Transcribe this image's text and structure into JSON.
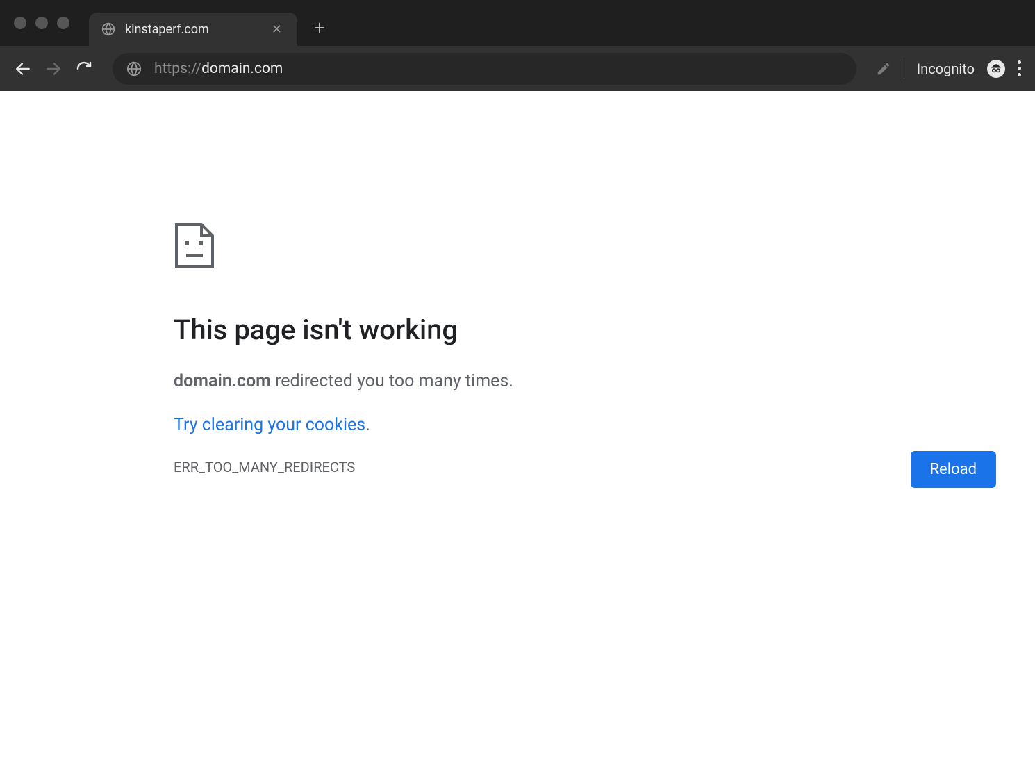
{
  "browser": {
    "tab": {
      "title": "kinstaperf.com"
    },
    "url": {
      "protocol": "https://",
      "domain": "domain.com"
    },
    "incognito_label": "Incognito"
  },
  "error": {
    "title": "This page isn't working",
    "domain_bold": "domain.com",
    "message_rest": " redirected you too many times.",
    "link_text": "Try clearing your cookies",
    "link_period": ".",
    "code": "ERR_TOO_MANY_REDIRECTS",
    "reload_label": "Reload"
  }
}
